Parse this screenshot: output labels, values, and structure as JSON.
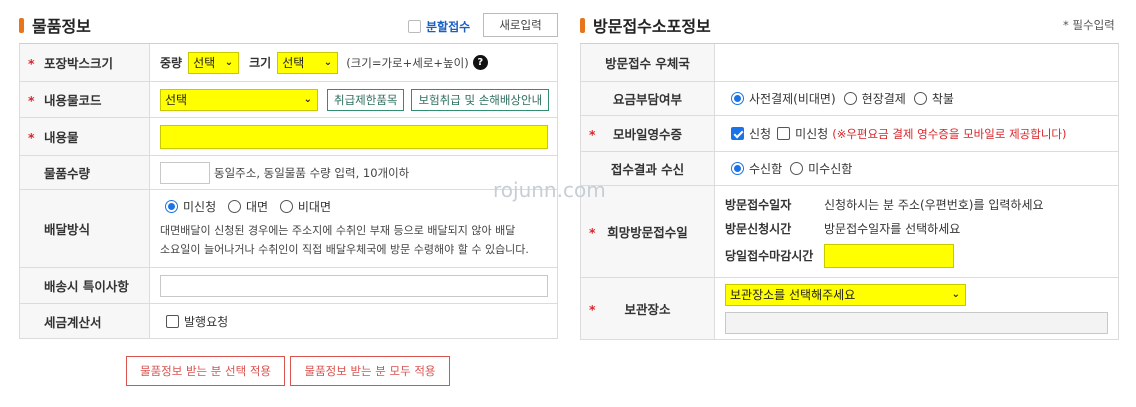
{
  "left": {
    "title": "물품정보",
    "split_label": "분할접수",
    "reset_button": "새로입력",
    "box_size": {
      "label": "포장박스크기",
      "weight_label": "중량",
      "weight_value": "선택",
      "size_label": "크기",
      "size_value": "선택",
      "hint": "(크기=가로+세로+높이)",
      "help_icon": "?"
    },
    "content_code": {
      "label": "내용물코드",
      "value": "선택",
      "btn1": "취급제한품목",
      "btn2": "보험취급 및 손해배상안내"
    },
    "content": {
      "label": "내용물",
      "value": ""
    },
    "quantity": {
      "label": "물품수량",
      "hint": "동일주소, 동일물품 수량 입력, 10개이하"
    },
    "delivery": {
      "label": "배달방식",
      "options": [
        "미신청",
        "대면",
        "비대면"
      ],
      "note1": "대면배달이 신청된 경우에는 주소지에 수취인 부재 등으로 배달되지 않아 배달",
      "note2": "소요일이 늘어나거나 수취인이 직접 배달우체국에 방문 수령해야 할 수 있습니다."
    },
    "special": {
      "label": "배송시 특이사항",
      "value": ""
    },
    "tax": {
      "label": "세금계산서",
      "option": "발행요청"
    }
  },
  "right": {
    "title": "방문접수소포정보",
    "required_note": "* 필수입력",
    "office": {
      "label": "방문접수 우체국",
      "value": ""
    },
    "payment": {
      "label": "요금부담여부",
      "options": [
        "사전결제(비대면)",
        "현장결제",
        "착불"
      ]
    },
    "receipt": {
      "label": "모바일영수증",
      "opt1": "신청",
      "opt2": "미신청",
      "note": "(※우편요금 결제 영수증을 모바일로 제공합니다)"
    },
    "result": {
      "label": "접수결과 수신",
      "options": [
        "수신함",
        "미수신함"
      ]
    },
    "visit": {
      "label": "희망방문접수일",
      "date_label": "방문접수일자",
      "date_value": "신청하시는 분 주소(우편번호)를 입력하세요",
      "time_label": "방문신청시간",
      "time_value": "방문접수일자를 선택하세요",
      "deadline_label": "당일접수마감시간",
      "deadline_value": ""
    },
    "storage": {
      "label": "보관장소",
      "placeholder": "보관장소를 선택해주세요",
      "detail": ""
    }
  },
  "watermark": "rojunn.com",
  "bottom": {
    "btn1": "물품정보 받는 분 선택 적용",
    "btn2": "물품정보 받는 분 모두 적용"
  },
  "colors": {
    "accent": "#e8741c",
    "required": "#d9262b",
    "highlight": "#ffff00",
    "green_btn": "#2f8f6f",
    "red_btn": "#d9534f"
  }
}
